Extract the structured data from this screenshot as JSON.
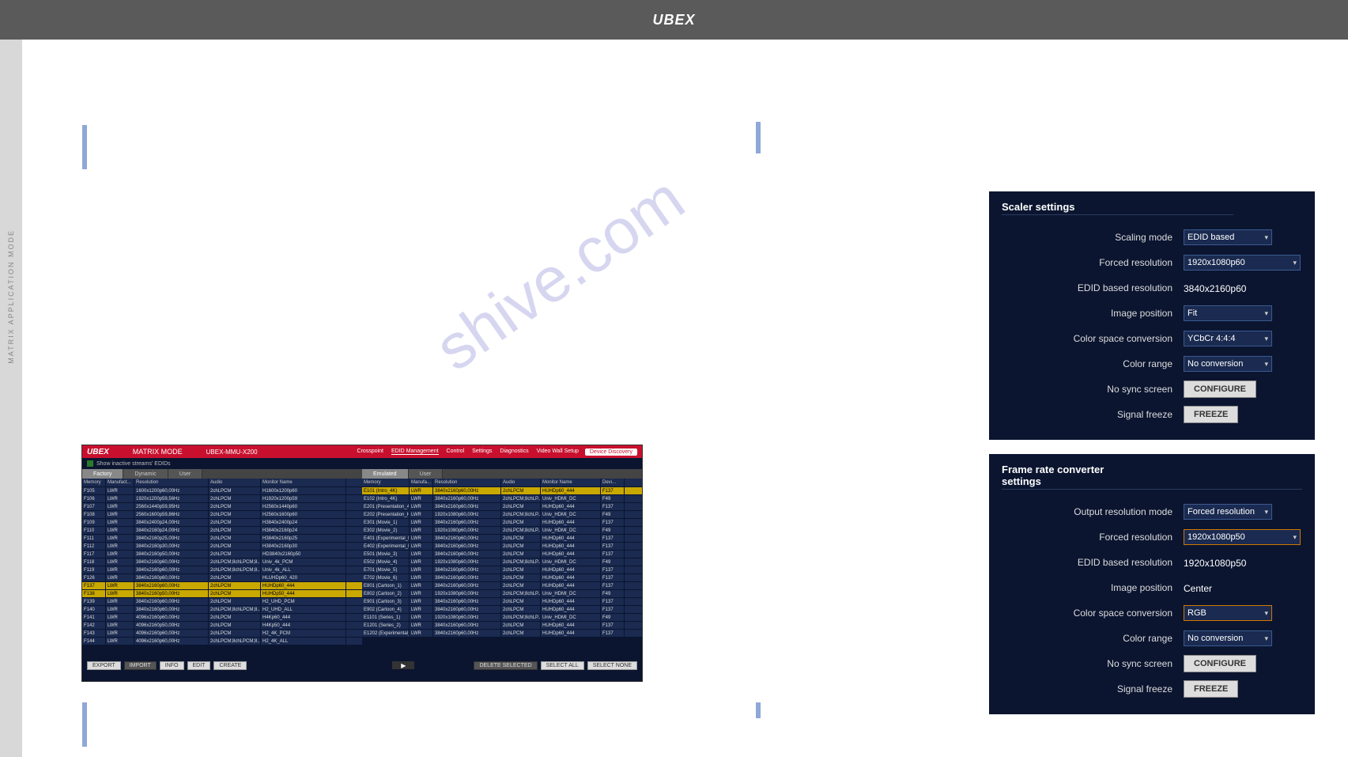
{
  "top_logo": "UBEX",
  "watermark": "shive.com",
  "sidebar_text": "MATRIX APPLICATION MODE",
  "edid": {
    "logo": "UBEX",
    "mode": "MATRIX MODE",
    "device": "UBEX-MMU-X200",
    "tabs": [
      "Crosspoint",
      "EDID Management",
      "Control",
      "Settings",
      "Diagnostics",
      "Video Wall Setup"
    ],
    "active_tab": "EDID Management",
    "discovery": "Device Discovery",
    "show_inactive": "Show inactive streams' EDIDs",
    "left_tabs": [
      "Factory",
      "Dynamic",
      "User"
    ],
    "left_active": "Factory",
    "right_tabs": [
      "Emulated",
      "User"
    ],
    "right_active": "Emulated",
    "left_headers": [
      "Memory",
      "Manufact...",
      "Resolution",
      "Audio",
      "Monitor Name"
    ],
    "left_rows": [
      {
        "mem": "F105",
        "manu": "LWR",
        "res": "1600x1200p60,00Hz",
        "aud": "2chLPCM",
        "mon": "H1600x1200p60"
      },
      {
        "mem": "F106",
        "manu": "LWR",
        "res": "1920x1200p59,56Hz",
        "aud": "2chLPCM",
        "mon": "H1920x1200p59"
      },
      {
        "mem": "F107",
        "manu": "LWR",
        "res": "2560x1440p59,95Hz",
        "aud": "2chLPCM",
        "mon": "H2560x1440p60"
      },
      {
        "mem": "F108",
        "manu": "LWR",
        "res": "2560x1600p59,86Hz",
        "aud": "2chLPCM",
        "mon": "H2560x1600p60"
      },
      {
        "mem": "F109",
        "manu": "LWR",
        "res": "3840x2400p24,00Hz",
        "aud": "2chLPCM",
        "mon": "H3840x2400p24"
      },
      {
        "mem": "F110",
        "manu": "LWR",
        "res": "3840x2160p24,00Hz",
        "aud": "2chLPCM",
        "mon": "H3840x2160p24"
      },
      {
        "mem": "F111",
        "manu": "LWR",
        "res": "3840x2160p25,00Hz",
        "aud": "2chLPCM",
        "mon": "H3840x2160p25"
      },
      {
        "mem": "F112",
        "manu": "LWR",
        "res": "3840x2160p30,00Hz",
        "aud": "2chLPCM",
        "mon": "H3840x2160p30"
      },
      {
        "mem": "F117",
        "manu": "LWR",
        "res": "3840x2160p50,00Hz",
        "aud": "2chLPCM",
        "mon": "HD3840x2160p50"
      },
      {
        "mem": "F118",
        "manu": "LWR",
        "res": "3840x2160p60,00Hz",
        "aud": "2chLPCM;8chLPCM;8...",
        "mon": "Univ_4k_PCM"
      },
      {
        "mem": "F119",
        "manu": "LWR",
        "res": "3840x2160p60,00Hz",
        "aud": "2chLPCM;8chLPCM;8...",
        "mon": "Univ_4k_ALL"
      },
      {
        "mem": "F126",
        "manu": "LWR",
        "res": "3840x2160p60,00Hz",
        "aud": "2chLPCM",
        "mon": "HLUHDp60_420"
      },
      {
        "mem": "F137",
        "manu": "LWR",
        "res": "3840x2160p60,00Hz",
        "aud": "2chLPCM",
        "mon": "HUHDp60_444",
        "sel": true
      },
      {
        "mem": "F138",
        "manu": "LWR",
        "res": "3840x2160p50,00Hz",
        "aud": "2chLPCM",
        "mon": "HUHDp50_444",
        "sel": true
      },
      {
        "mem": "F139",
        "manu": "LWR",
        "res": "3840x2160p60,00Hz",
        "aud": "2chLPCM",
        "mon": "H2_UHD_PCM"
      },
      {
        "mem": "F140",
        "manu": "LWR",
        "res": "3840x2160p60,00Hz",
        "aud": "2chLPCM;8chLPCM;8...",
        "mon": "H2_UHD_ALL"
      },
      {
        "mem": "F141",
        "manu": "LWR",
        "res": "4096x2160p60,00Hz",
        "aud": "2chLPCM",
        "mon": "H4Kp60_444"
      },
      {
        "mem": "F142",
        "manu": "LWR",
        "res": "4096x2160p50,00Hz",
        "aud": "2chLPCM",
        "mon": "H4Kp50_444"
      },
      {
        "mem": "F143",
        "manu": "LWR",
        "res": "4096x2160p60,00Hz",
        "aud": "2chLPCM",
        "mon": "H2_4K_PCM"
      },
      {
        "mem": "F144",
        "manu": "LWR",
        "res": "4096x2160p60,00Hz",
        "aud": "2chLPCM;8chLPCM;8...",
        "mon": "H2_4K_ALL"
      }
    ],
    "right_headers": [
      "Memory",
      "Manufa...",
      "Resolution",
      "Audio",
      "Monitor Name",
      "Devi..."
    ],
    "right_rows": [
      {
        "mem": "E101 (Intro_4K)",
        "manu": "LWR",
        "res": "3840x2160p60,00Hz",
        "aud": "2chLPCM",
        "mon": "HUHDp60_444",
        "dev": "F137",
        "sel": true
      },
      {
        "mem": "E102 (Intro_4K)",
        "manu": "LWR",
        "res": "3840x2160p60,00Hz",
        "aud": "2chLPCM;8chLP...",
        "mon": "Univ_HDMI_DC",
        "dev": "F49"
      },
      {
        "mem": "E201 (Presentation_4K)",
        "manu": "LWR",
        "res": "3840x2160p60,00Hz",
        "aud": "2chLPCM",
        "mon": "HUHDp60_444",
        "dev": "F137"
      },
      {
        "mem": "E202 (Presentation_HD)",
        "manu": "LWR",
        "res": "1920x1080p60,00Hz",
        "aud": "2chLPCM;8chLP...",
        "mon": "Univ_HDMI_DC",
        "dev": "F49"
      },
      {
        "mem": "E301 (Movie_1)",
        "manu": "LWR",
        "res": "3840x2160p60,00Hz",
        "aud": "2chLPCM",
        "mon": "HUHDp60_444",
        "dev": "F137"
      },
      {
        "mem": "E302 (Movie_2)",
        "manu": "LWR",
        "res": "1920x1080p60,00Hz",
        "aud": "2chLPCM;8chLP...",
        "mon": "Univ_HDMI_DC",
        "dev": "F49"
      },
      {
        "mem": "E401 (Experimental_M...)",
        "manu": "LWR",
        "res": "3840x2160p60,00Hz",
        "aud": "2chLPCM",
        "mon": "HUHDp60_444",
        "dev": "F137"
      },
      {
        "mem": "E402 (Experimental_M...)",
        "manu": "LWR",
        "res": "3840x2160p60,00Hz",
        "aud": "2chLPCM",
        "mon": "HUHDp60_444",
        "dev": "F137"
      },
      {
        "mem": "E501 (Movie_3)",
        "manu": "LWR",
        "res": "3840x2160p60,00Hz",
        "aud": "2chLPCM",
        "mon": "HUHDp60_444",
        "dev": "F137"
      },
      {
        "mem": "E502 (Movie_4)",
        "manu": "LWR",
        "res": "1920x1080p60,00Hz",
        "aud": "2chLPCM;8chLP...",
        "mon": "Univ_HDMI_DC",
        "dev": "F49"
      },
      {
        "mem": "E701 (Movie_5)",
        "manu": "LWR",
        "res": "3840x2160p60,00Hz",
        "aud": "2chLPCM",
        "mon": "HUHDp60_444",
        "dev": "F137"
      },
      {
        "mem": "E702 (Movie_6)",
        "manu": "LWR",
        "res": "3840x2160p60,00Hz",
        "aud": "2chLPCM",
        "mon": "HUHDp60_444",
        "dev": "F137"
      },
      {
        "mem": "E801 (Cartoon_1)",
        "manu": "LWR",
        "res": "3840x2160p60,00Hz",
        "aud": "2chLPCM",
        "mon": "HUHDp60_444",
        "dev": "F137"
      },
      {
        "mem": "E802 (Cartoon_2)",
        "manu": "LWR",
        "res": "1920x1080p60,00Hz",
        "aud": "2chLPCM;8chLP...",
        "mon": "Univ_HDMI_DC",
        "dev": "F49"
      },
      {
        "mem": "E901 (Cartoon_3)",
        "manu": "LWR",
        "res": "3840x2160p60,00Hz",
        "aud": "2chLPCM",
        "mon": "HUHDp60_444",
        "dev": "F137"
      },
      {
        "mem": "E902 (Cartoon_4)",
        "manu": "LWR",
        "res": "3840x2160p60,00Hz",
        "aud": "2chLPCM",
        "mon": "HUHDp60_444",
        "dev": "F137"
      },
      {
        "mem": "E1101 (Series_1)",
        "manu": "LWR",
        "res": "1920x1080p60,00Hz",
        "aud": "2chLPCM;8chLP...",
        "mon": "Univ_HDMI_DC",
        "dev": "F49"
      },
      {
        "mem": "E1201 (Series_2)",
        "manu": "LWR",
        "res": "3840x2160p60,00Hz",
        "aud": "2chLPCM",
        "mon": "HUHDp60_444",
        "dev": "F137"
      },
      {
        "mem": "E1202 (Experimental_P...)",
        "manu": "LWR",
        "res": "3840x2160p60,00Hz",
        "aud": "2chLPCM",
        "mon": "HUHDp60_444",
        "dev": "F137"
      }
    ],
    "footer": {
      "export": "EXPORT",
      "import": "IMPORT",
      "info": "INFO",
      "edit": "EDIT",
      "create": "CREATE",
      "delete_selected": "DELETE SELECTED",
      "select_all": "SELECT ALL",
      "select_none": "SELECT NONE"
    }
  },
  "scaler": {
    "title": "Scaler settings",
    "rows": {
      "scaling_mode": {
        "label": "Scaling mode",
        "value": "EDID based"
      },
      "forced_res": {
        "label": "Forced resolution",
        "value": "1920x1080p60"
      },
      "edid_res": {
        "label": "EDID based resolution",
        "value": "3840x2160p60"
      },
      "image_pos": {
        "label": "Image position",
        "value": "Fit"
      },
      "color_space": {
        "label": "Color space conversion",
        "value": "YCbCr 4:4:4"
      },
      "color_range": {
        "label": "Color range",
        "value": "No conversion"
      },
      "no_sync": {
        "label": "No sync screen",
        "button": "CONFIGURE"
      },
      "freeze": {
        "label": "Signal freeze",
        "button": "FREEZE"
      }
    }
  },
  "frc": {
    "title": "Frame rate converter settings",
    "rows": {
      "out_mode": {
        "label": "Output resolution mode",
        "value": "Forced resolution"
      },
      "forced_res": {
        "label": "Forced resolution",
        "value": "1920x1080p50"
      },
      "edid_res": {
        "label": "EDID based resolution",
        "value": "1920x1080p50"
      },
      "image_pos": {
        "label": "Image position",
        "value": "Center"
      },
      "color_space": {
        "label": "Color space conversion",
        "value": "RGB"
      },
      "color_range": {
        "label": "Color range",
        "value": "No conversion"
      },
      "no_sync": {
        "label": "No sync screen",
        "button": "CONFIGURE"
      },
      "freeze": {
        "label": "Signal freeze",
        "button": "FREEZE"
      }
    }
  }
}
